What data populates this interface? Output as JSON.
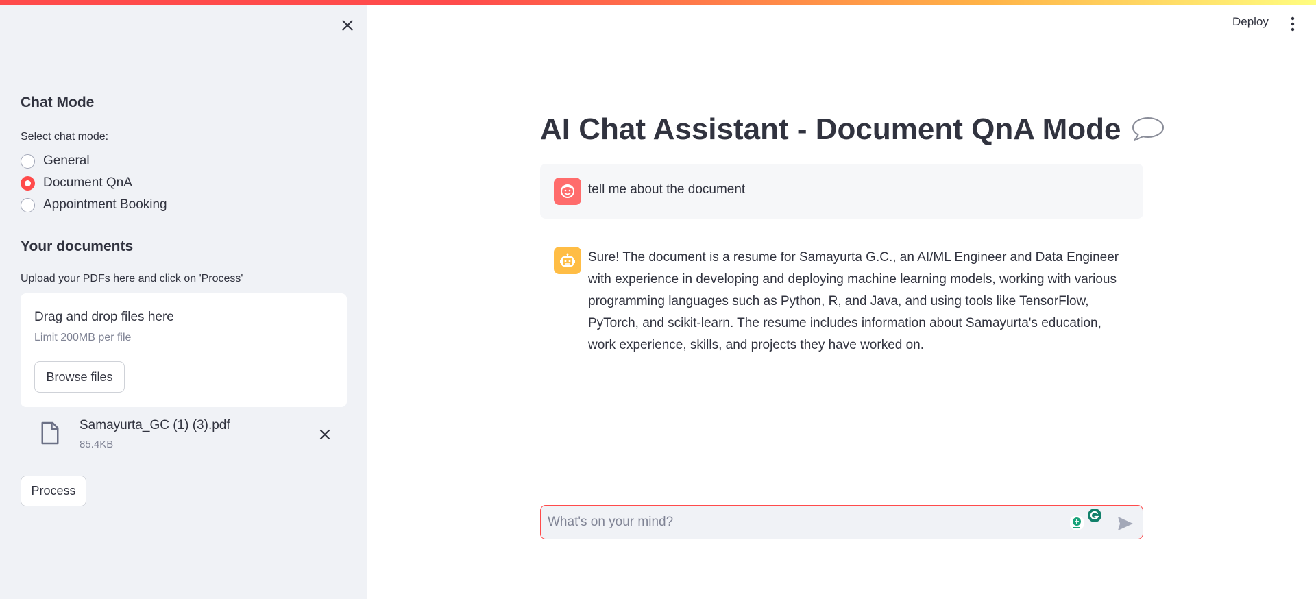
{
  "sidebar": {
    "chat_mode_heading": "Chat Mode",
    "select_label": "Select chat mode:",
    "modes": [
      {
        "label": "General",
        "selected": false
      },
      {
        "label": "Document QnA",
        "selected": true
      },
      {
        "label": "Appointment Booking",
        "selected": false
      }
    ],
    "documents_heading": "Your documents",
    "upload_hint": "Upload your PDFs here and click on 'Process'",
    "dropzone": {
      "title": "Drag and drop files here",
      "limit": "Limit 200MB per file",
      "browse_label": "Browse files"
    },
    "file": {
      "name": "Samayurta_GC (1) (3).pdf",
      "size": "85.4KB"
    },
    "process_label": "Process"
  },
  "header": {
    "deploy_label": "Deploy"
  },
  "main": {
    "title": "AI Chat Assistant - Document QnA Mode",
    "messages": [
      {
        "role": "user",
        "text": "tell me about the document"
      },
      {
        "role": "assistant",
        "text": "Sure! The document is a resume for Samayurta G.C., an AI/ML Engineer and Data Engineer with experience in developing and deploying machine learning models, working with various programming languages such as Python, R, and Java, and using tools like TensorFlow, PyTorch, and scikit-learn. The resume includes information about Samayurta's education, work experience, skills, and projects they have worked on."
      }
    ],
    "input_placeholder": "What's on your mind?"
  },
  "colors": {
    "accent": "#ff4b4b",
    "sidebar_bg": "#f0f2f6",
    "user_avatar": "#ff6c6c",
    "bot_avatar": "#ffbd45",
    "text": "#31333f"
  },
  "icons": [
    "close-icon",
    "radio-icon",
    "file-icon",
    "remove-file-icon",
    "kebab-menu-icon",
    "speech-balloon-icon",
    "user-avatar-icon",
    "bot-avatar-icon",
    "grammarly-icon",
    "extension-icon",
    "send-icon"
  ]
}
